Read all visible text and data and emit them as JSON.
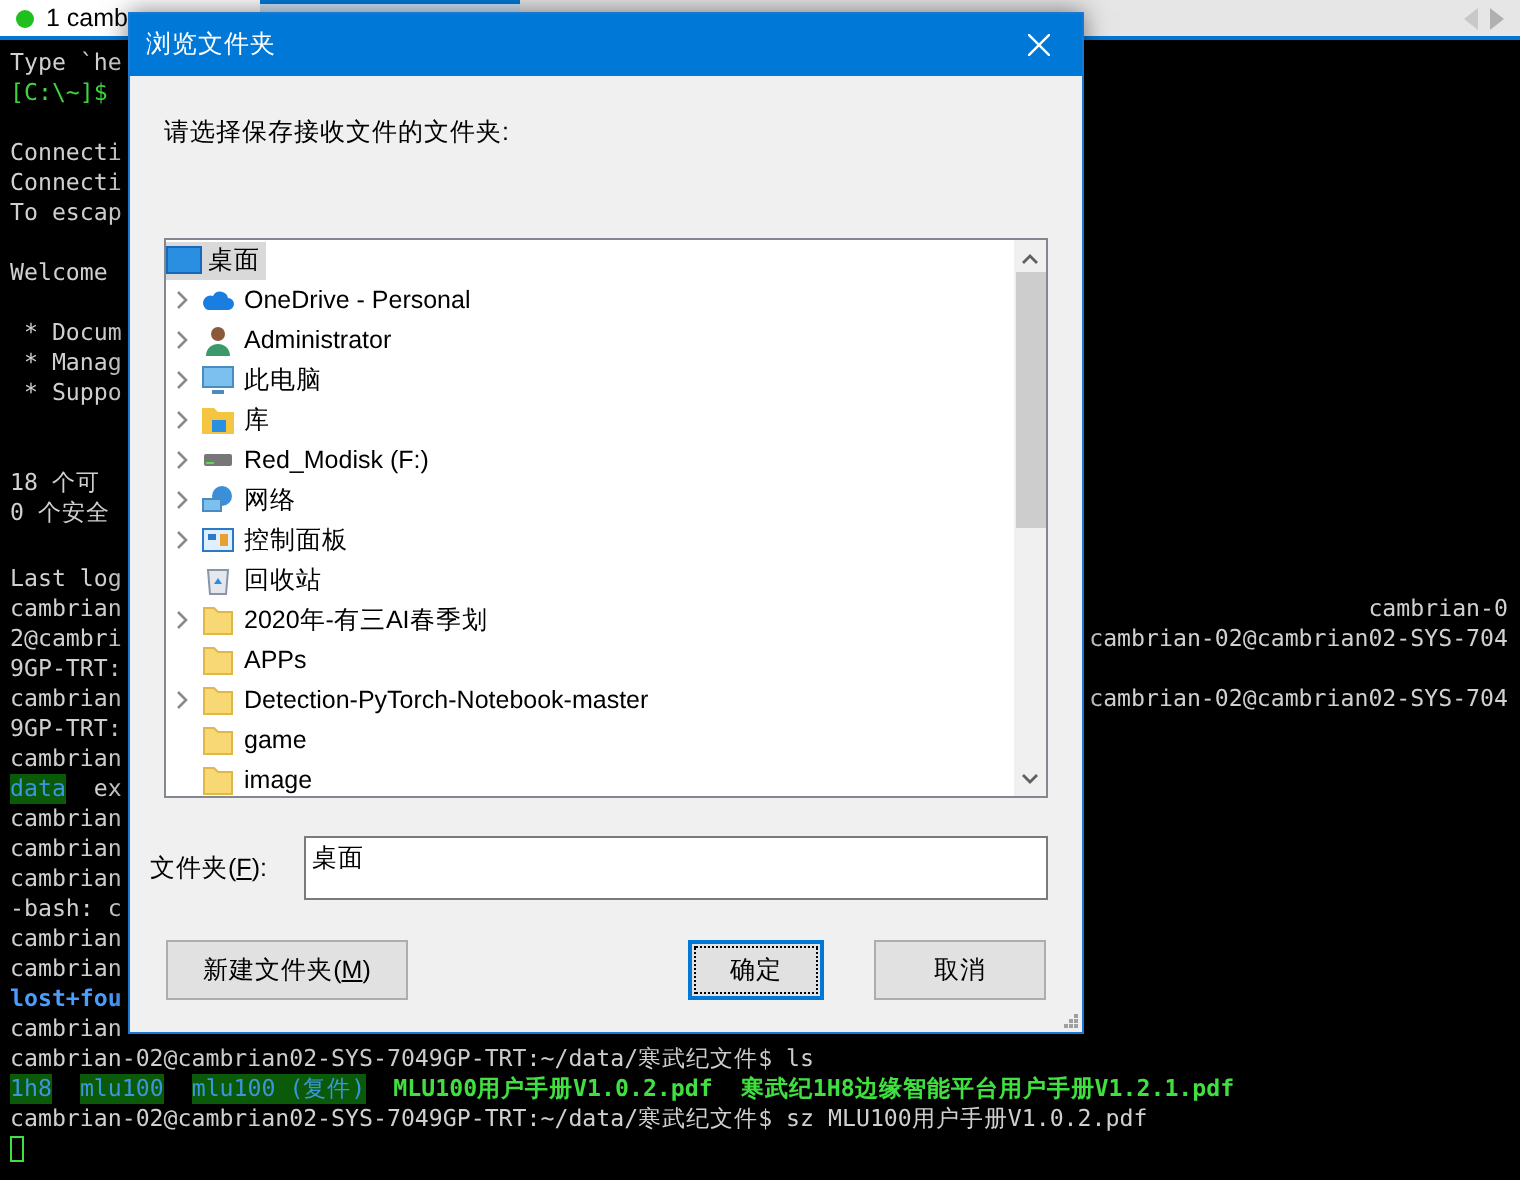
{
  "tabs": [
    {
      "label": "1 camb",
      "selected": false
    },
    {
      "selected": true
    }
  ],
  "terminal": {
    "top_blocks": [
      {
        "lines": [
          {
            "segments": [
              {
                "text": "Type `he",
                "kind": "plain"
              }
            ]
          },
          {
            "segments": [
              {
                "text": "[C:\\~]$",
                "kind": "prompt"
              }
            ]
          }
        ]
      },
      {
        "lines": [
          {
            "segments": [
              {
                "text": "Connecti",
                "kind": "plain"
              }
            ]
          },
          {
            "segments": [
              {
                "text": "Connecti",
                "kind": "plain"
              }
            ]
          },
          {
            "segments": [
              {
                "text": "To escap",
                "kind": "plain"
              }
            ]
          }
        ]
      },
      {
        "lines": [
          {
            "segments": [
              {
                "text": "Welcome",
                "kind": "plain"
              }
            ]
          }
        ]
      },
      {
        "lines": [
          {
            "segments": [
              {
                "text": " * Docum",
                "kind": "plain"
              }
            ]
          },
          {
            "segments": [
              {
                "text": " * Manag",
                "kind": "plain"
              }
            ]
          },
          {
            "segments": [
              {
                "text": " * Suppo",
                "kind": "plain"
              }
            ]
          }
        ]
      },
      {
        "lines": [
          {
            "segments": [
              {
                "text": "18 个可",
                "kind": "plain"
              }
            ]
          },
          {
            "segments": [
              {
                "text": "0 个安全",
                "kind": "plain"
              }
            ]
          }
        ]
      }
    ],
    "bottom_lines": [
      {
        "segments": [
          {
            "text": "Last log",
            "kind": "plain"
          }
        ]
      },
      {
        "segments": [
          {
            "text": "cambrian",
            "kind": "plain"
          }
        ],
        "right": "cambrian-0"
      },
      {
        "segments": [
          {
            "text": "2@cambri",
            "kind": "plain"
          }
        ],
        "right": "cambrian-02@cambrian02-SYS-704"
      },
      {
        "segments": [
          {
            "text": "9GP-TRT:",
            "kind": "plain"
          }
        ]
      },
      {
        "segments": [
          {
            "text": "cambrian",
            "kind": "plain"
          }
        ],
        "right": "cambrian-02@cambrian02-SYS-704"
      },
      {
        "segments": [
          {
            "text": "9GP-TRT:",
            "kind": "plain"
          }
        ]
      },
      {
        "segments": [
          {
            "text": "cambrian",
            "kind": "plain"
          }
        ]
      },
      {
        "segments": [
          {
            "text": "data",
            "kind": "highlight"
          },
          {
            "text": "ex",
            "kind": "plain"
          }
        ]
      },
      {
        "segments": [
          {
            "text": "cambrian",
            "kind": "plain"
          }
        ]
      },
      {
        "segments": [
          {
            "text": "cambrian",
            "kind": "plain"
          }
        ]
      },
      {
        "segments": [
          {
            "text": "cambrian",
            "kind": "plain"
          }
        ]
      },
      {
        "segments": [
          {
            "text": "-bash: c",
            "kind": "plain"
          }
        ]
      },
      {
        "segments": [
          {
            "text": "cambrian",
            "kind": "plain"
          }
        ]
      },
      {
        "segments": [
          {
            "text": "cambrian",
            "kind": "plain"
          }
        ]
      },
      {
        "segments": [
          {
            "text": "lost+fou",
            "kind": "dir"
          }
        ]
      },
      {
        "segments": [
          {
            "text": "cambrian",
            "kind": "plain"
          }
        ]
      },
      {
        "segments": [
          {
            "text": "cambrian-02@cambrian02-SYS-7049GP-TRT:~/data/寒武纪文件$ ls",
            "kind": "plain"
          }
        ]
      },
      {
        "segments": [
          {
            "text": "1h8",
            "kind": "highlight"
          },
          {
            "text": "mlu100",
            "kind": "highlight"
          },
          {
            "text": "mlu100 (复件)",
            "kind": "highlight"
          },
          {
            "text": "MLU100用户手册V1.0.2.pdf",
            "kind": "file"
          },
          {
            "text": "寒武纪1H8边缘智能平台用户手册V1.2.1.pdf",
            "kind": "file"
          }
        ]
      },
      {
        "segments": [
          {
            "text": "cambrian-02@cambrian02-SYS-7049GP-TRT:~/data/寒武纪文件$ sz MLU100用户手册V1.0.2.pdf",
            "kind": "plain"
          }
        ]
      }
    ],
    "cursor": true
  },
  "dialog": {
    "title": "浏览文件夹",
    "prompt": "请选择保存接收文件的文件夹:",
    "tree": {
      "label": "桌面",
      "kind": "desktop",
      "selected": true,
      "children": [
        {
          "label": "OneDrive - Personal",
          "kind": "cloud",
          "expandable": true,
          "selected": false
        },
        {
          "label": "Administrator",
          "kind": "user",
          "expandable": true,
          "selected": false
        },
        {
          "label": "此电脑",
          "kind": "computer",
          "expandable": true,
          "selected": false
        },
        {
          "label": "库",
          "kind": "library",
          "expandable": true,
          "selected": false
        },
        {
          "label": "Red_Modisk (F:)",
          "kind": "drive",
          "expandable": true,
          "selected": false
        },
        {
          "label": "网络",
          "kind": "network",
          "expandable": true,
          "selected": false
        },
        {
          "label": "控制面板",
          "kind": "panel",
          "expandable": true,
          "selected": false
        },
        {
          "label": "回收站",
          "kind": "bin",
          "expandable": false,
          "selected": false
        },
        {
          "label": "2020年-有三AI春季划",
          "kind": "folder",
          "expandable": true,
          "selected": false
        },
        {
          "label": "APPs",
          "kind": "folder",
          "expandable": false,
          "selected": false
        },
        {
          "label": "Detection-PyTorch-Notebook-master",
          "kind": "folder",
          "expandable": true,
          "selected": false
        },
        {
          "label": "game",
          "kind": "folder",
          "expandable": false,
          "selected": false
        },
        {
          "label": "image",
          "kind": "folder",
          "expandable": false,
          "selected": false
        }
      ]
    },
    "folder_field": {
      "label_before": "文件夹(",
      "mnemonic": "F",
      "label_after": "):",
      "value": "桌面"
    },
    "buttons": [
      {
        "label_before": "新建文件夹(",
        "mnemonic": "M",
        "label_after": ")",
        "default": false
      },
      {
        "label_before": "确定",
        "default": true
      },
      {
        "label_before": "取消",
        "default": false
      }
    ]
  }
}
